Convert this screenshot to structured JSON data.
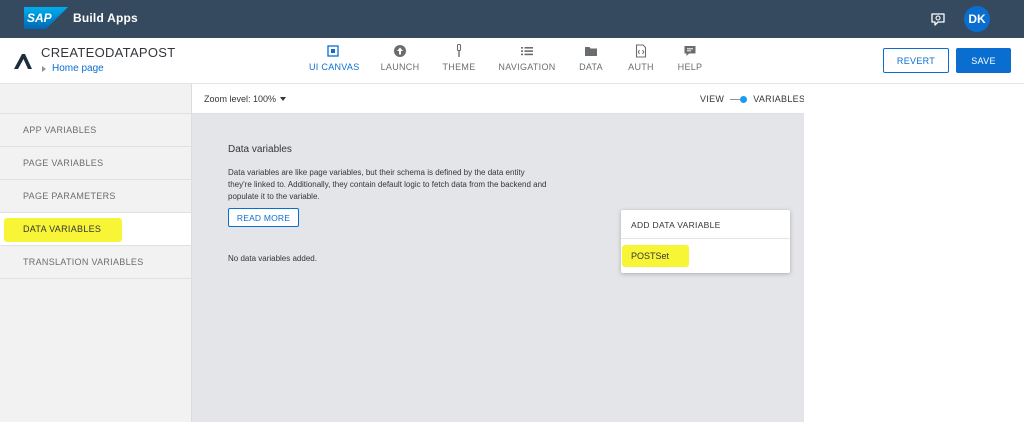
{
  "shell": {
    "logo": "SAP",
    "product": "Build",
    "product2": "Apps",
    "avatar_initials": "DK",
    "colors": {
      "shell_bg": "#354a5f",
      "accent": "#0a6ed1",
      "highlight": "#f8f32b"
    }
  },
  "app": {
    "name": "CREATEODATAPOST",
    "breadcrumb": "Home page"
  },
  "nav": {
    "ui_canvas": "UI CANVAS",
    "launch": "LAUNCH",
    "theme": "THEME",
    "navigation": "NAVIGATION",
    "data": "DATA",
    "auth": "AUTH",
    "help": "HELP"
  },
  "actions": {
    "revert": "REVERT",
    "save": "SAVE"
  },
  "sidebar": {
    "items": [
      {
        "label": "APP VARIABLES"
      },
      {
        "label": "PAGE VARIABLES"
      },
      {
        "label": "PAGE PARAMETERS"
      },
      {
        "label": "DATA VARIABLES"
      },
      {
        "label": "TRANSLATION VARIABLES"
      }
    ]
  },
  "toolbar": {
    "zoom_label": "Zoom level: 100%",
    "view_label": "VIEW",
    "variables_label": "VARIABLES"
  },
  "canvas": {
    "title": "Data variables",
    "description": "Data variables are like page variables, but their schema is defined by the data entity they're linked to. Additionally, they contain default logic to fetch data from the backend and populate it to the variable.",
    "read_more": "READ MORE",
    "empty_text": "No data variables added."
  },
  "dropdown": {
    "header": "ADD DATA VARIABLE",
    "items": [
      "POSTSet"
    ]
  }
}
